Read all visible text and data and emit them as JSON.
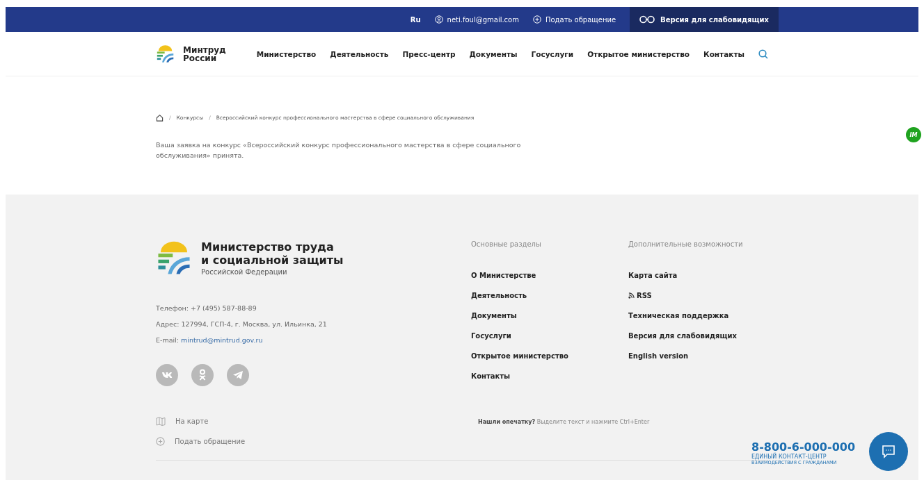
{
  "topbar": {
    "language": "Ru",
    "user": "neti.foul@gmail.com",
    "appeal": "Подать обращение",
    "accessibility": "Версия для слабовидящих"
  },
  "header": {
    "logo_line1": "Минтруд",
    "logo_line2": "России",
    "nav": [
      "Министерство",
      "Деятельность",
      "Пресс-центр",
      "Документы",
      "Госуслуги",
      "Открытое министерство",
      "Контакты"
    ]
  },
  "breadcrumb_separator": "/",
  "breadcrumbs": [
    "Конкурсы",
    "Всероссийский конкурс профессионального мастерства в сфере социального обслуживания"
  ],
  "message": "Ваша заявка на конкурс «Всероссийский конкурс профессионального мастерства в сфере социального обслуживания» принята.",
  "footer": {
    "title_line1": "Министерство труда",
    "title_line2": "и социальной защиты",
    "subtitle": "Российской Федерации",
    "contacts": [
      {
        "kind": "text",
        "label": "Телефон:",
        "value": "+7 (495) 587-88-89"
      },
      {
        "kind": "text",
        "label": "Адрес:",
        "value": "127994, ГСП-4, г. Москва, ул. Ильинка, 21"
      },
      {
        "kind": "email",
        "label": "E-mail:",
        "value": "mintrud@mintrud.gov.ru"
      }
    ],
    "map_link": "На карте",
    "appeal_link": "Подать обращение",
    "main_heading": "Основные разделы",
    "main_links": [
      "О Министерстве",
      "Деятельность",
      "Документы",
      "Госуслуги",
      "Открытое министерство",
      "Контакты"
    ],
    "extra_heading": "Дополнительные возможности",
    "extra_links": [
      {
        "kind": "link",
        "label": "Карта сайта"
      },
      {
        "kind": "rss",
        "label": "RSS"
      },
      {
        "kind": "link",
        "label": "Техническая поддержка"
      },
      {
        "kind": "link",
        "label": "Версия для слабовидящих"
      },
      {
        "kind": "link",
        "label": "English version"
      }
    ],
    "typo_note": "**Нашли опечатку?** Выделите текст и нажмите Ctrl+Enter"
  },
  "contact_center": {
    "phone": "8-800-6-000-000",
    "line1": "ЕДИНЫЙ КОНТАКТ-ЦЕНТР",
    "line2": "ВЗАИМОДЕЙСТВИЯ С ГРАЖДАНАМИ"
  },
  "side_badge": "IM"
}
